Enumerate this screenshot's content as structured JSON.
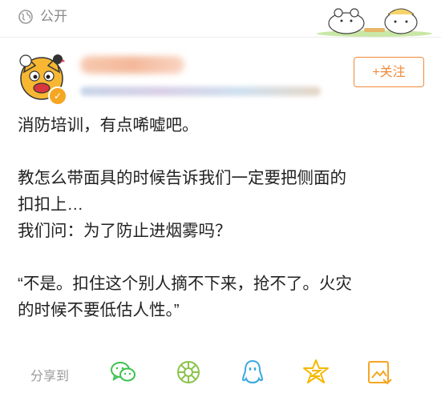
{
  "header": {
    "visibility_label": "公开"
  },
  "user": {
    "follow_label": "+关注"
  },
  "post": {
    "lines": [
      "消防培训，有点唏嘘吧。",
      "教怎么带面具的时候告诉我们一定要把侧面的",
      "扣扣上…",
      "我们问：为了防止进烟雾吗？",
      "“不是。扣住这个别人摘不下来，抢不了。火灾",
      "的时候不要低估人性。”"
    ]
  },
  "share": {
    "label": "分享到",
    "targets": [
      "wechat-icon",
      "moments-icon",
      "qq-icon",
      "qzone-icon",
      "save-image-icon"
    ]
  },
  "colors": {
    "accent": "#f08a3a",
    "muted": "#8a8a8a",
    "wechat": "#3cc24f",
    "moments": "#8bc34a",
    "qq": "#39a9e0",
    "qzone": "#f5b800",
    "save": "#f5a623"
  }
}
